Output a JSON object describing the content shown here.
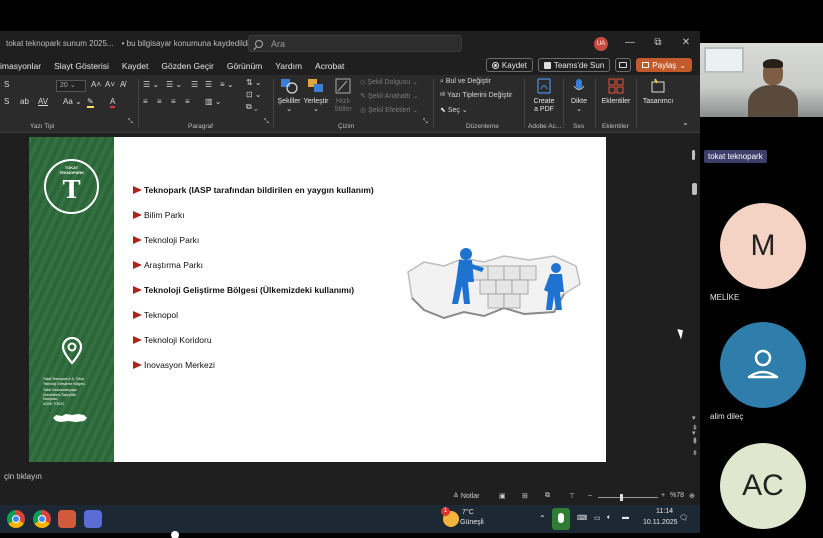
{
  "window": {
    "doc_title": "tokat teknopark sunum 2025...",
    "save_status": "• bu bilgisayar konumuna kaydedildi ⌄",
    "search_placeholder": "Ara",
    "user_initials": "UA",
    "minimize": "—",
    "restore": "⧉",
    "close": "✕"
  },
  "menu": {
    "tabs": [
      "imasyonlar",
      "Slayt Gösterisi",
      "Kaydet",
      "Gözden Geçir",
      "Görünüm",
      "Yardım",
      "Acrobat"
    ],
    "record_label": "Kaydet",
    "teams_label": "Teams'de Sun",
    "share_label": "Paylaş",
    "comment_icon": "comment-icon"
  },
  "ribbon": {
    "font_size": "20",
    "group_labels": {
      "font": "Yazı Tipi",
      "paragraph": "Paragraf",
      "drawing": "Çizim",
      "editing": "Düzenleme",
      "adobe": "Adobe Ac...",
      "voice": "Ses",
      "addins": "Eklentiler"
    },
    "shapes_label": "Şekiller",
    "arrange_label": "Yerleştir",
    "quick_styles_label": "Hızlı\nStiller",
    "shape_outline": "Şekil Dolgusu",
    "shape_fill": "Şekil Anahattı",
    "shape_effects": "Şekil Efektleri",
    "find_replace": "Bul ve Değiştir",
    "replace_fonts": "Yazı Tiplerini Değiştir",
    "select": "Seç",
    "create_pdf": "Create\na PDF",
    "dictate": "Dikte",
    "addins": "Eklentiler",
    "designer": "Tasarımcı"
  },
  "slide": {
    "logo_top_text": "TOKAT",
    "logo_mid_text": "TEKNOPARK",
    "logo_ring_text": "Tokat Teknoloji Geliştirme Bölgesi",
    "address_lines": [
      "Tokat Teknopark A.Ş. Tokat",
      "Teknoloji Geliştirme Bölgesi,",
      "Tokat Gaziosmanpaşa",
      "Üniversitesi Taşlıçiftlik",
      "Kampüsü,",
      "60250 TOKAT"
    ],
    "bullets": [
      {
        "text": "Teknopark  (IASP tarafından bildirilen en yaygın kullanım)",
        "bold": true
      },
      {
        "text": "Bilim Parkı",
        "bold": false
      },
      {
        "text": "Teknoloji Parkı",
        "bold": false
      },
      {
        "text": "Araştırma Parkı",
        "bold": false
      },
      {
        "text": "Teknoloji Geliştirme Bölgesi (Ülkemizdeki kullanımı)",
        "bold": true
      },
      {
        "text": "Teknopol",
        "bold": false
      },
      {
        "text": "Teknoloji Koridoru",
        "bold": false
      },
      {
        "text": "İnovasyon Merkezi",
        "bold": false
      }
    ]
  },
  "notes": {
    "placeholder": "çin tıklayın"
  },
  "statusbar": {
    "notes_label": "Notlar",
    "zoom": "%78"
  },
  "taskbar": {
    "weather_temp": "7°C",
    "weather_desc": "Güneşli",
    "time": "11:14",
    "date": "10.11.2025",
    "notification_count": "1"
  },
  "meeting": {
    "presenter_name": "tokat teknopark",
    "participants": [
      {
        "initials": "M",
        "name": "MELİKE",
        "color": "#f4d3c4"
      },
      {
        "initials": "",
        "name": "alim dileç",
        "color": "#2e7daa"
      },
      {
        "initials": "AC",
        "name": "",
        "color": "#dfe7cf"
      }
    ]
  }
}
